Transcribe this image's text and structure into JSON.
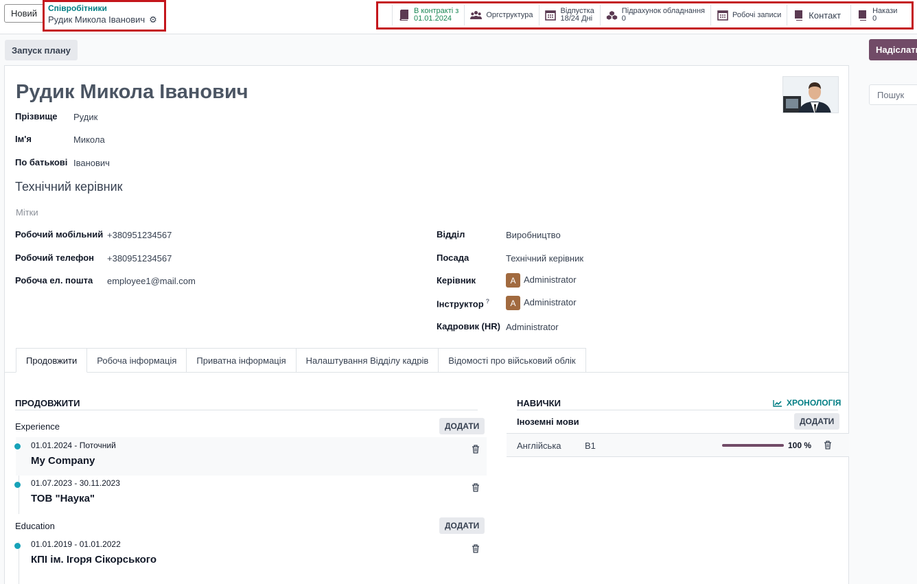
{
  "header": {
    "new_button": "Новий",
    "breadcrumb_parent": "Співробітники",
    "breadcrumb_current": "Рудик Микола Іванович",
    "smart_buttons": [
      {
        "line1": "В контракті з",
        "line2": "01.01.2024",
        "icon": "book-icon"
      },
      {
        "line1": "Оргструктура",
        "icon": "users-icon"
      },
      {
        "line1": "Відпустка",
        "line2": "18/24 Дні",
        "icon": "calendar-icon"
      },
      {
        "line1": "Підрахунок обладнання",
        "line2": "0",
        "icon": "cubes-icon"
      },
      {
        "line1": "Робочі записи",
        "icon": "calendar-icon"
      },
      {
        "line1": "Контакт",
        "icon": "book-icon"
      },
      {
        "line1": "Накази",
        "line2": "0",
        "icon": "book-icon"
      }
    ]
  },
  "actions": {
    "plan_button": "Запуск плану",
    "send_button": "Надіслати",
    "search_placeholder": "Пошук"
  },
  "employee": {
    "full_name": "Рудик Микола Іванович",
    "fields": [
      {
        "label": "Прізвище",
        "value": "Рудик"
      },
      {
        "label": "Ім'я",
        "value": "Микола"
      },
      {
        "label": "По батькові",
        "value": "Іванович"
      }
    ],
    "job_title": "Технічний керівник",
    "tags_placeholder": "Мітки",
    "contact": [
      {
        "label": "Робочий мобільний",
        "value": "+380951234567"
      },
      {
        "label": "Робочий телефон",
        "value": "+380951234567"
      },
      {
        "label": "Робоча ел. пошта",
        "value": "employee1@mail.com"
      }
    ],
    "org": {
      "department_label": "Відділ",
      "department": "Виробництво",
      "position_label": "Посада",
      "position": "Технічний керівник",
      "manager_label": "Керівник",
      "manager": "Administrator",
      "coach_label": "Інструктор",
      "coach": "Administrator",
      "coach_help": "?",
      "hr_label": "Кадровик (HR)",
      "hr": "Administrator",
      "avatar_letter": "A"
    }
  },
  "tabs": [
    "Продовжити",
    "Робоча інформація",
    "Приватна інформація",
    "Налаштування Відділу кадрів",
    "Відомості про військовий облік"
  ],
  "resume": {
    "title": "ПРОДОВЖИТИ",
    "add_label": "ДОДАТИ",
    "experience_title": "Experience",
    "experience": [
      {
        "dates": "01.01.2024 - Поточний",
        "name": "My Company"
      },
      {
        "dates": "01.07.2023 - 30.11.2023",
        "name": "ТОВ \"Наука\""
      }
    ],
    "education_title": "Education",
    "education": [
      {
        "dates": "01.01.2019 - 01.01.2022",
        "name": "КПІ ім. Ігоря Сікорського"
      }
    ]
  },
  "skills": {
    "title": "НАВИЧКИ",
    "chronology": "ХРОНОЛОГІЯ",
    "group": "Іноземні мови",
    "add_label": "ДОДАТИ",
    "items": [
      {
        "name": "Англійська",
        "level": "B1",
        "progress": "100 %",
        "progress_fraction": 1.0
      }
    ]
  },
  "colors": {
    "accent": "#714b67",
    "teal": "#017e84",
    "highlight": "#c4161c",
    "dot": "#17a2b8"
  }
}
